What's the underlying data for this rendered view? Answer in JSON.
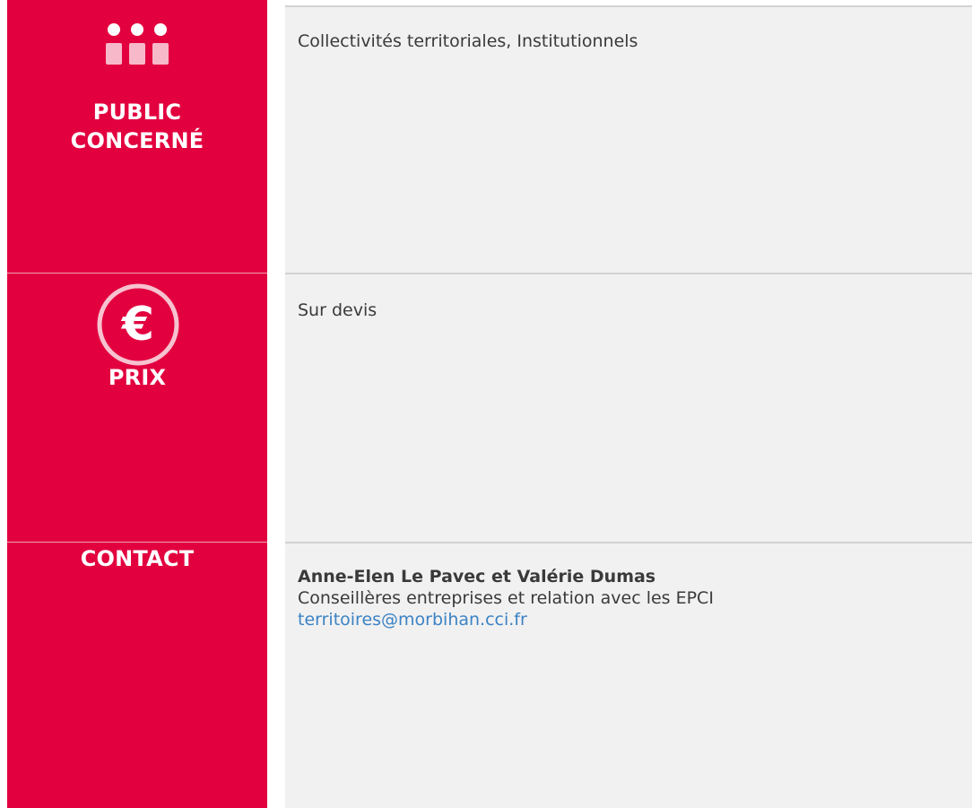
{
  "sections": [
    {
      "label": "PUBLIC CONCERNÉ",
      "label_line1": "PUBLIC",
      "label_line2": "CONCERNÉ",
      "icon": "people-icon",
      "content": "Collectivités territoriales, Institutionnels"
    },
    {
      "label": "PRIX",
      "icon": "euro-icon",
      "content": "Sur devis"
    },
    {
      "label": "CONTACT",
      "contact_name": "Anne-Elen Le Pavec et Valérie Dumas",
      "contact_role": "Conseillères entreprises et relation avec les EPCI",
      "contact_email": "territoires@morbihan.cci.fr"
    }
  ],
  "colors": {
    "label_background": "#e2003f",
    "content_background": "#f1f1f1",
    "link": "#3b82c4"
  }
}
